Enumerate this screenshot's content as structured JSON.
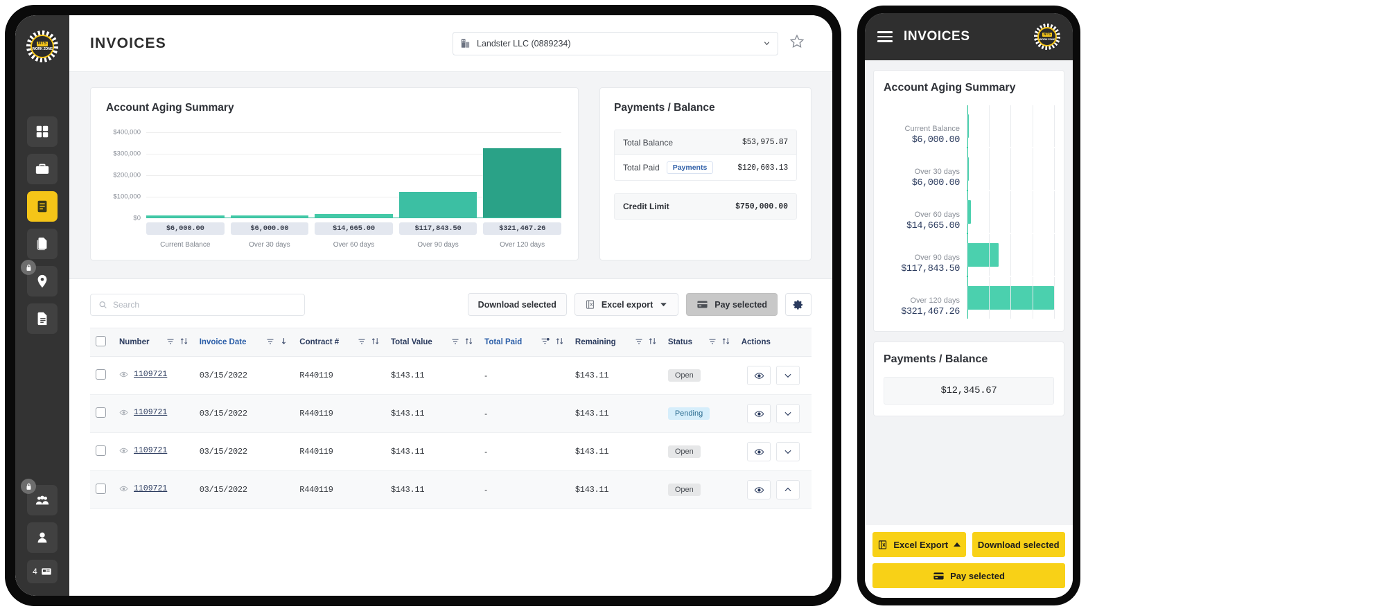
{
  "brand": {
    "logo_top": "NTS",
    "logo_bottom": "WORK ZONE"
  },
  "sidebar": {
    "items": [
      {
        "name": "dashboard",
        "icon": "grid-icon",
        "active": false
      },
      {
        "name": "briefcase",
        "icon": "briefcase-icon",
        "active": false
      },
      {
        "name": "invoices",
        "icon": "invoice-icon",
        "active": true
      },
      {
        "name": "documents",
        "icon": "documents-icon",
        "active": false
      },
      {
        "name": "locations",
        "icon": "location-lock-icon",
        "active": false
      },
      {
        "name": "reports",
        "icon": "report-icon",
        "active": false
      },
      {
        "name": "teams",
        "icon": "users-lock-icon",
        "active": false
      },
      {
        "name": "profile",
        "icon": "person-icon",
        "active": false
      }
    ],
    "badge_count": "4"
  },
  "header": {
    "title": "INVOICES",
    "account": "Landster LLC (0889234)",
    "account_icon": "building-icon",
    "star_icon": "star-icon",
    "caret_icon": "chevron-down-icon"
  },
  "aging_card": {
    "title": "Account Aging Summary"
  },
  "chart_data": {
    "type": "bar",
    "title": "Account Aging Summary",
    "categories": [
      "Current Balance",
      "Over 30 days",
      "Over 60 days",
      "Over 90 days",
      "Over 120 days"
    ],
    "values": [
      6000,
      6000,
      14665,
      117843.5,
      321467.26
    ],
    "value_labels": [
      "$6,000.00",
      "$6,000.00",
      "$14,665.00",
      "$117,843.50",
      "$321,467.26"
    ],
    "ytick_labels": [
      "$400,000",
      "$300,000",
      "$200,000",
      "$100,000",
      "$0"
    ],
    "yticks": [
      400000,
      300000,
      200000,
      100000,
      0
    ],
    "ylim": [
      0,
      400000
    ],
    "xlabel": "",
    "ylabel": "",
    "grid": true,
    "legend": "none",
    "bar_colors": [
      "#43c9a7",
      "#43c9a7",
      "#43c9a7",
      "#3cbfa3",
      "#2aa287"
    ]
  },
  "payments_card": {
    "title": "Payments / Balance",
    "rows": [
      {
        "label": "Total Balance",
        "value": "$53,975.87",
        "pill": null
      },
      {
        "label": "Total Paid",
        "value": "$120,603.13",
        "pill": "Payments"
      }
    ],
    "credit": {
      "label": "Credit Limit",
      "value": "$750,000.00"
    }
  },
  "toolbar": {
    "search_placeholder": "Search",
    "search_value": "",
    "download_label": "Download selected",
    "excel_label": "Excel export",
    "pay_label": "Pay selected",
    "settings_icon": "gear-icon"
  },
  "table": {
    "columns": [
      {
        "label": "Number",
        "sortable": true,
        "filter": true,
        "sort": "both"
      },
      {
        "label": "Invoice Date",
        "sortable": true,
        "filter": true,
        "sort": "desc",
        "active": true
      },
      {
        "label": "Contract #",
        "sortable": true,
        "filter": true,
        "sort": "both"
      },
      {
        "label": "Total Value",
        "sortable": true,
        "filter": true,
        "sort": "both"
      },
      {
        "label": "Total Paid",
        "sortable": true,
        "filter": true,
        "sort": "both",
        "active": true
      },
      {
        "label": "Remaining",
        "sortable": true,
        "filter": true,
        "sort": "both"
      },
      {
        "label": "Status",
        "sortable": true,
        "filter": true,
        "sort": "both"
      },
      {
        "label": "Actions",
        "sortable": false,
        "filter": false
      }
    ],
    "rows": [
      {
        "number": "1109721",
        "date": "03/15/2022",
        "contract": "R440119",
        "total_value": "$143.11",
        "total_paid": "-",
        "remaining": "$143.11",
        "status": "Open",
        "status_kind": "open",
        "expanded": false
      },
      {
        "number": "1109721",
        "date": "03/15/2022",
        "contract": "R440119",
        "total_value": "$143.11",
        "total_paid": "-",
        "remaining": "$143.11",
        "status": "Pending",
        "status_kind": "pending",
        "expanded": false
      },
      {
        "number": "1109721",
        "date": "03/15/2022",
        "contract": "R440119",
        "total_value": "$143.11",
        "total_paid": "-",
        "remaining": "$143.11",
        "status": "Open",
        "status_kind": "open",
        "expanded": false
      },
      {
        "number": "1109721",
        "date": "03/15/2022",
        "contract": "R440119",
        "total_value": "$143.11",
        "total_paid": "-",
        "remaining": "$143.11",
        "status": "Open",
        "status_kind": "open",
        "expanded": true
      }
    ]
  },
  "phone": {
    "title": "INVOICES",
    "menu_icon": "hamburger-icon",
    "aging_title": "Account Aging Summary",
    "payments_title": "Payments / Balance",
    "balance_value": "$12,345.67",
    "buttons": {
      "excel": "Excel Export",
      "download": "Download selected",
      "pay": "Pay selected"
    }
  },
  "colors": {
    "accent_yellow": "#f8d117",
    "teal": "#43c9a7",
    "teal_dark": "#2aa287",
    "sidebar": "#333333",
    "navy_text": "#2b3b5e"
  }
}
